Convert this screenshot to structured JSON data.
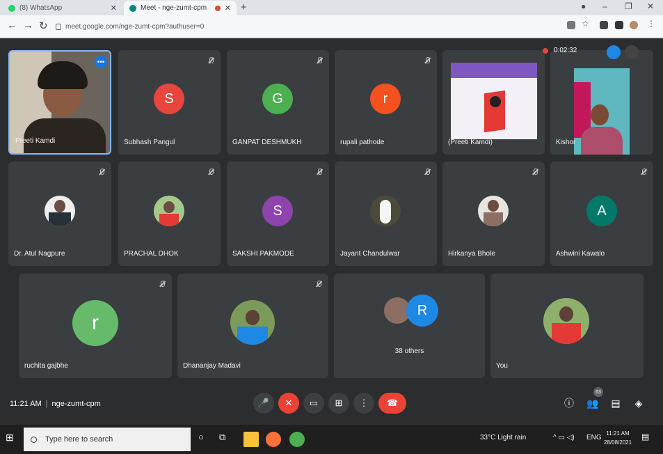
{
  "browser": {
    "tabs": [
      {
        "title": "(8) WhatsApp",
        "active": false
      },
      {
        "title": "Meet - nge-zumt-cpm",
        "active": true
      }
    ],
    "url": "meet.google.com/nge-zumt-cpm?authuser=0"
  },
  "recording": {
    "time": "0:02:32"
  },
  "participants": [
    {
      "name": "Preeti Kamdi",
      "type": "video"
    },
    {
      "name": "Subhash Pangul",
      "initial": "S",
      "color": "#e8453c"
    },
    {
      "name": "GANPAT DESHMUKH",
      "initial": "G",
      "color": "#4caf50"
    },
    {
      "name": "rupali pathode",
      "initial": "r",
      "color": "#f4511e"
    },
    {
      "name": "(Preeti Kamdi)",
      "type": "presentation"
    },
    {
      "name": "Kishor",
      "type": "video"
    },
    {
      "name": "Dr. Atul Nagpure",
      "type": "photo"
    },
    {
      "name": "PRACHAL DHOK",
      "type": "photo"
    },
    {
      "name": "SAKSHI PAKMODE",
      "initial": "S",
      "color": "#8e44ad"
    },
    {
      "name": "Jayant Chandulwar",
      "type": "photo"
    },
    {
      "name": "Hirkanya Bhole",
      "type": "photo"
    },
    {
      "name": "Ashwini Kawalo",
      "initial": "A",
      "color": "#00796b"
    },
    {
      "name": "ruchita gajbhe",
      "initial": "r",
      "color": "#66bb6a"
    },
    {
      "name": "Dhananjay Madavi",
      "type": "photo"
    },
    {
      "name": "38 others",
      "initial": "R",
      "color": "#1e88e5"
    },
    {
      "name": "You",
      "type": "photo"
    }
  ],
  "controls": {
    "time": "11:21 AM",
    "meeting_code": "nge-zumt-cpm",
    "participant_count": "63"
  },
  "taskbar": {
    "search_placeholder": "Type here to search",
    "weather": "33°C  Light rain",
    "lang": "ENG",
    "time": "11:21 AM",
    "date": "28/08/2021"
  }
}
